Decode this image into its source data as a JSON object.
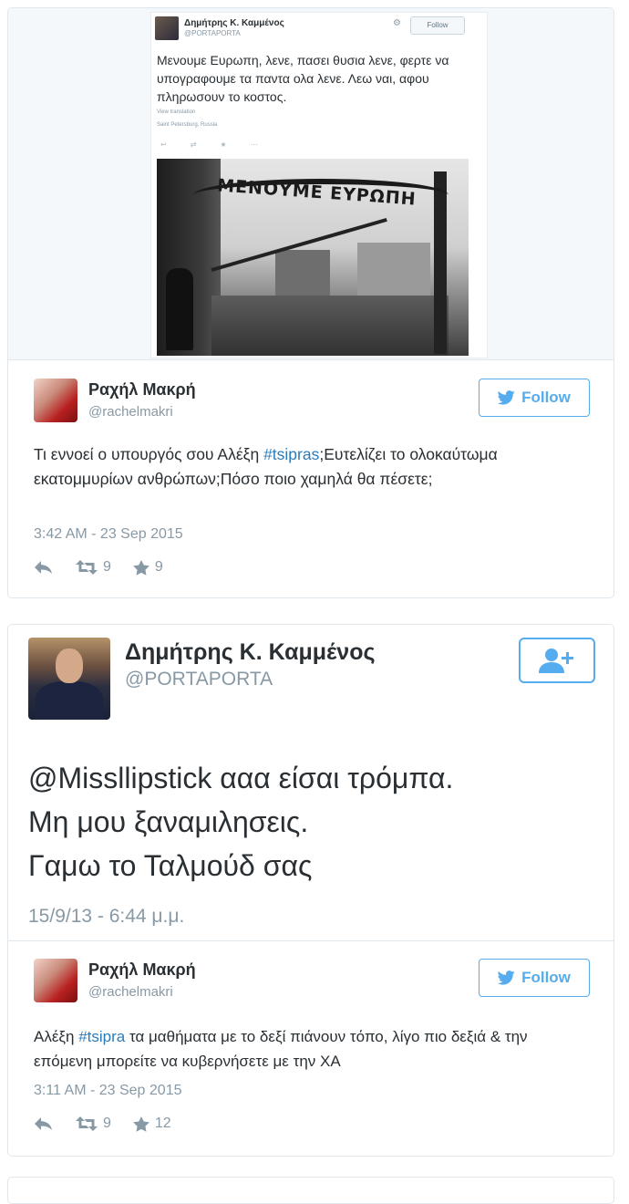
{
  "embedded_screenshot": {
    "name": "Δημήτρης Κ. Καμμένος",
    "handle": "@PORTAPORTA",
    "follow_label": "Follow",
    "text": "Μενουμε Ευρωπη, λενε, πασει θυσια λενε, φερτε να υπογραφουμε τα παντα ολα λενε. Λεω ναι, αφου πληρωσουν το κοστος.",
    "view_translation": "View translation",
    "location": "Saint Petersburg, Russia",
    "photo_sign": "ΜΕΝΟΥΜΕ ΕΥΡΩΠΗ"
  },
  "tweet1": {
    "name": "Ραχήλ Μακρή",
    "handle": "@rachelmakri",
    "follow_label": "Follow",
    "text_before": "Τι εννοεί ο υπουργός σου Αλέξη ",
    "hashtag": "#tsipras",
    "text_after": ";Ευτελίζει το ολοκαύτωμα εκατομμυρίων ανθρώπων;Πόσο ποιο χαμηλά θα πέσετε;",
    "time": "3:42 AM - 23 Sep 2015",
    "retweets": "9",
    "favorites": "9"
  },
  "quoted": {
    "name": "Δημήτρης Κ. Καμμένος",
    "handle": "@PORTAPORTA",
    "line1": "@Missllipstick ααα είσαι τρόμπα.",
    "line2": "Μη μου ξαναμιλησεις.",
    "line3": "Γαμω το Ταλμούδ σας",
    "time": "15/9/13 - 6:44 μ.μ."
  },
  "tweet2": {
    "name": "Ραχήλ Μακρή",
    "handle": "@rachelmakri",
    "follow_label": "Follow",
    "text_before": "Αλέξη ",
    "hashtag": "#tsipra",
    "text_after": " τα μαθήματα με το δεξί πιάνουν τόπο, λίγο πιο δεξιά & την επόμενη μπορείτε να κυβερνήσετε με την ΧΑ",
    "time": "3:11 AM - 23 Sep 2015",
    "retweets": "9",
    "favorites": "12"
  },
  "colors": {
    "link": "#2b7bb9",
    "twitter_blue": "#55acee",
    "muted": "#8899a6"
  },
  "icons": [
    "reply-icon",
    "retweet-icon",
    "favorite-star-icon",
    "twitter-bird-icon",
    "add-user-icon",
    "gear-icon"
  ]
}
